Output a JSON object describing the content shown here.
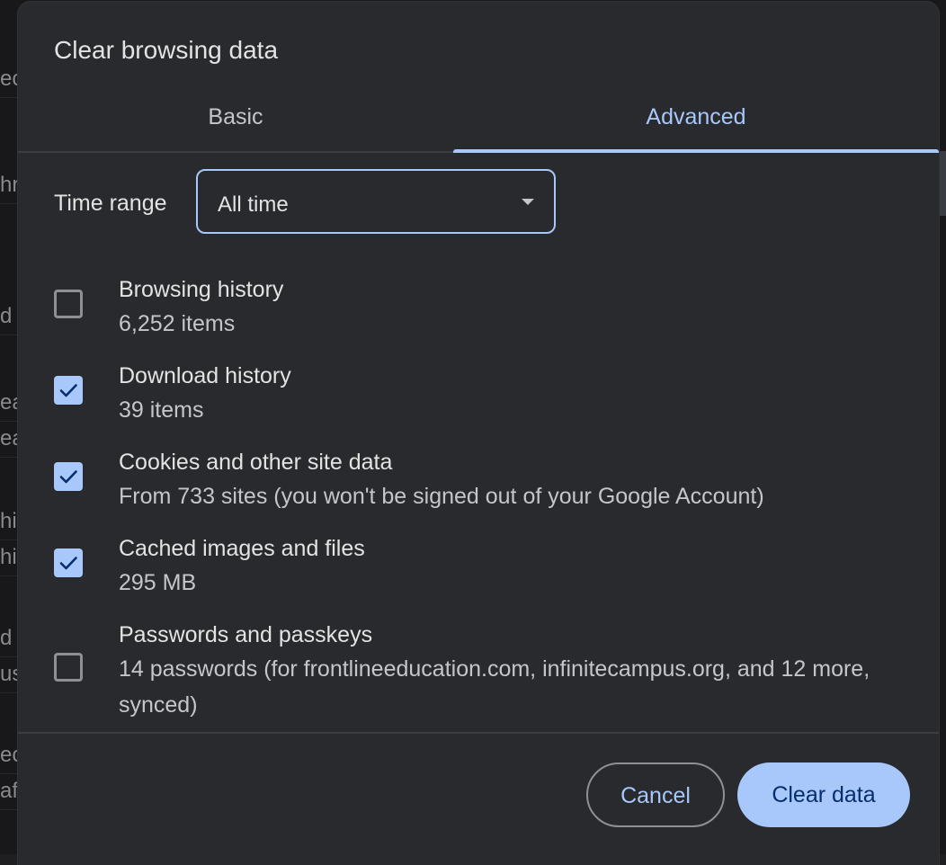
{
  "background": {
    "fragments": [
      "ec",
      "hro",
      "d",
      "ea",
      "ea",
      "hir",
      "hir",
      "d p",
      "us",
      "ec",
      "afe"
    ]
  },
  "dialog": {
    "title": "Clear browsing data",
    "tabs": [
      {
        "label": "Basic",
        "active": false
      },
      {
        "label": "Advanced",
        "active": true
      }
    ],
    "time_range": {
      "label": "Time range",
      "value": "All time"
    },
    "options": [
      {
        "title": "Browsing history",
        "subtitle": "6,252 items",
        "checked": false
      },
      {
        "title": "Download history",
        "subtitle": "39 items",
        "checked": true
      },
      {
        "title": "Cookies and other site data",
        "subtitle": "From 733 sites (you won't be signed out of your Google Account)",
        "checked": true
      },
      {
        "title": "Cached images and files",
        "subtitle": "295 MB",
        "checked": true
      },
      {
        "title": "Passwords and passkeys",
        "subtitle": "14 passwords (for frontlineeducation.com, infinitecampus.org, and 12 more, synced)",
        "checked": false
      }
    ],
    "buttons": {
      "cancel": "Cancel",
      "clear": "Clear data"
    }
  },
  "colors": {
    "accent": "#a8c7fa",
    "dialog_bg": "#292a2d",
    "clear_button_text": "#062e6f"
  }
}
